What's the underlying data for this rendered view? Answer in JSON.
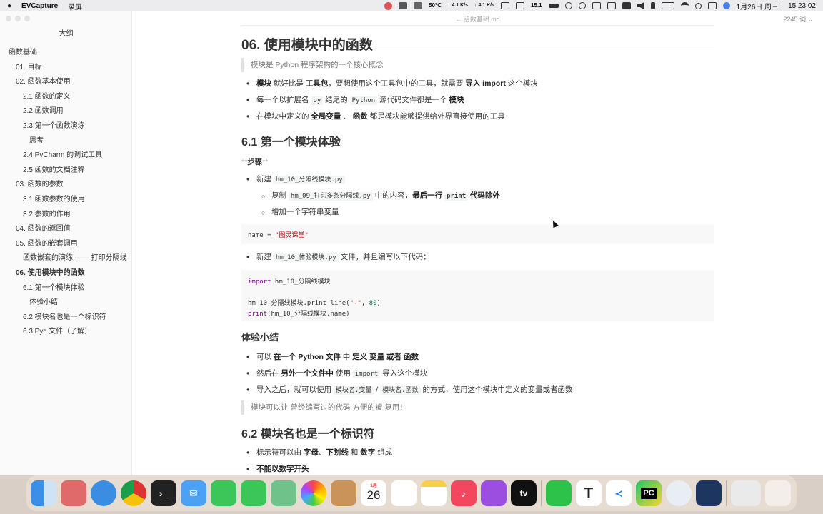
{
  "menubar": {
    "app_name": "EVCapture",
    "menu_item": "录屏",
    "temperature": "50°C",
    "net_up": "↑ 4.1 K/s",
    "net_down": "↓ 4.1 K/s",
    "stat": "15.1",
    "date": "1月26日 周三",
    "time": "15:23:02"
  },
  "window": {
    "title": "← 函数基础.md",
    "word_count": "2245 词 ⌄"
  },
  "sidebar": {
    "title": "大纲",
    "items": [
      {
        "label": "函数基础",
        "level": 1
      },
      {
        "label": "01. 目标",
        "level": 2
      },
      {
        "label": "02. 函数基本使用",
        "level": 2
      },
      {
        "label": "2.1 函数的定义",
        "level": 3
      },
      {
        "label": "2.2 函数调用",
        "level": 3
      },
      {
        "label": "2.3 第一个函数演练",
        "level": 3
      },
      {
        "label": "思考",
        "level": 4
      },
      {
        "label": "2.4 PyCharm 的调试工具",
        "level": 3
      },
      {
        "label": "2.5 函数的文档注释",
        "level": 3
      },
      {
        "label": "03. 函数的参数",
        "level": 2
      },
      {
        "label": "3.1 函数参数的使用",
        "level": 3
      },
      {
        "label": "3.2 参数的作用",
        "level": 3
      },
      {
        "label": "04. 函数的返回值",
        "level": 2
      },
      {
        "label": "05. 函数的嵌套调用",
        "level": 2
      },
      {
        "label": "函数嵌套的演练 —— 打印分隔线",
        "level": 3
      },
      {
        "label": "06. 使用模块中的函数",
        "level": 2,
        "active": true
      },
      {
        "label": "6.1 第一个模块体验",
        "level": 3
      },
      {
        "label": "体验小结",
        "level": 4
      },
      {
        "label": "6.2 模块名也是一个标识符",
        "level": 3
      },
      {
        "label": "6.3 Pyc 文件（了解）",
        "level": 3
      }
    ]
  },
  "doc": {
    "h06": "06. 使用模块中的函数",
    "quote1": "模块是 Python 程序架构的一个核心概念",
    "b1": {
      "p1": "模块",
      "p2": " 就好比是 ",
      "p3": "工具包",
      "p4": "，要想使用这个工具包中的工具，就需要 ",
      "p5": "导入 import",
      "p6": " 这个模块"
    },
    "b2": {
      "p1": "每一个以扩展名 ",
      "code1": "py",
      "p2": " 结尾的 ",
      "code2": "Python",
      "p3": " 源代码文件都是一个 ",
      "p4": "模块"
    },
    "b3": {
      "p1": "在模块中定义的 ",
      "p2": "全局变量",
      "p3": " 、 ",
      "p4": "函数",
      "p5": " 都是模块能够提供给外界直接使用的工具"
    },
    "h61": "6.1 第一个模块体验",
    "steps": {
      "stars_l": "**",
      "label": "步骤",
      "stars_r": "**"
    },
    "s1": {
      "p1": "新建 ",
      "code": "hm_10_分隔线模块.py"
    },
    "s1a": {
      "p1": "复制 ",
      "code1": "hm_09_打印多条分隔线.py",
      "p2": " 中的内容，",
      "p3": "最后一行 ",
      "code2": "print",
      "p4": " 代码除外"
    },
    "s1b": "增加一个字符串变量",
    "code1": {
      "var": "name",
      "eq": " = ",
      "str": "\"图灵课堂\""
    },
    "s2": {
      "p1": "新建 ",
      "code": "hm_10_体验模块.py",
      "p2": " 文件，并且编写以下代码："
    },
    "code2": {
      "l1_kw": "import",
      "l1_rest": " hm_10_分隔线模块",
      "l2_a": "hm_10_分隔线模块.print_line(",
      "l2_str": "\"-\"",
      "l2_b": ", ",
      "l2_num": "80",
      "l2_c": ")",
      "l3_kw": "print",
      "l3_rest": "(hm_10_分隔线模块.name)"
    },
    "h_summary": "体验小结",
    "t1": {
      "p1": "可以 ",
      "p2": "在一个 Python 文件",
      "p3": " 中 ",
      "p4": "定义 变量 或者 函数"
    },
    "t2": {
      "p1": "然后在 ",
      "p2": "另外一个文件中",
      "p3": " 使用 ",
      "code": "import",
      "p4": " 导入这个模块"
    },
    "t3": {
      "p1": "导入之后，就可以使用 ",
      "code1": "模块名.变量",
      "p2": " / ",
      "code2": "模块名.函数",
      "p3": " 的方式，使用这个模块中定义的变量或者函数"
    },
    "quote2": "模块可以让 曾经编写过的代码 方便的被 复用！",
    "h62": "6.2 模块名也是一个标识符",
    "u1": {
      "p1": "标示符可以由 ",
      "p2": "字母",
      "p3": "、",
      "p4": "下划线",
      "p5": " 和 ",
      "p6": "数字",
      "p7": " 组成"
    },
    "u2": "不能以数字开头"
  },
  "dock": {
    "calendar_month": "1月",
    "calendar_day": "26",
    "tv_label": "tv",
    "typora_label": "T",
    "pycharm_label": "PC"
  },
  "colors": {
    "keyword": "#770088",
    "string": "#aa1111",
    "number": "#116644",
    "quote_border": "#dfe2e5"
  }
}
